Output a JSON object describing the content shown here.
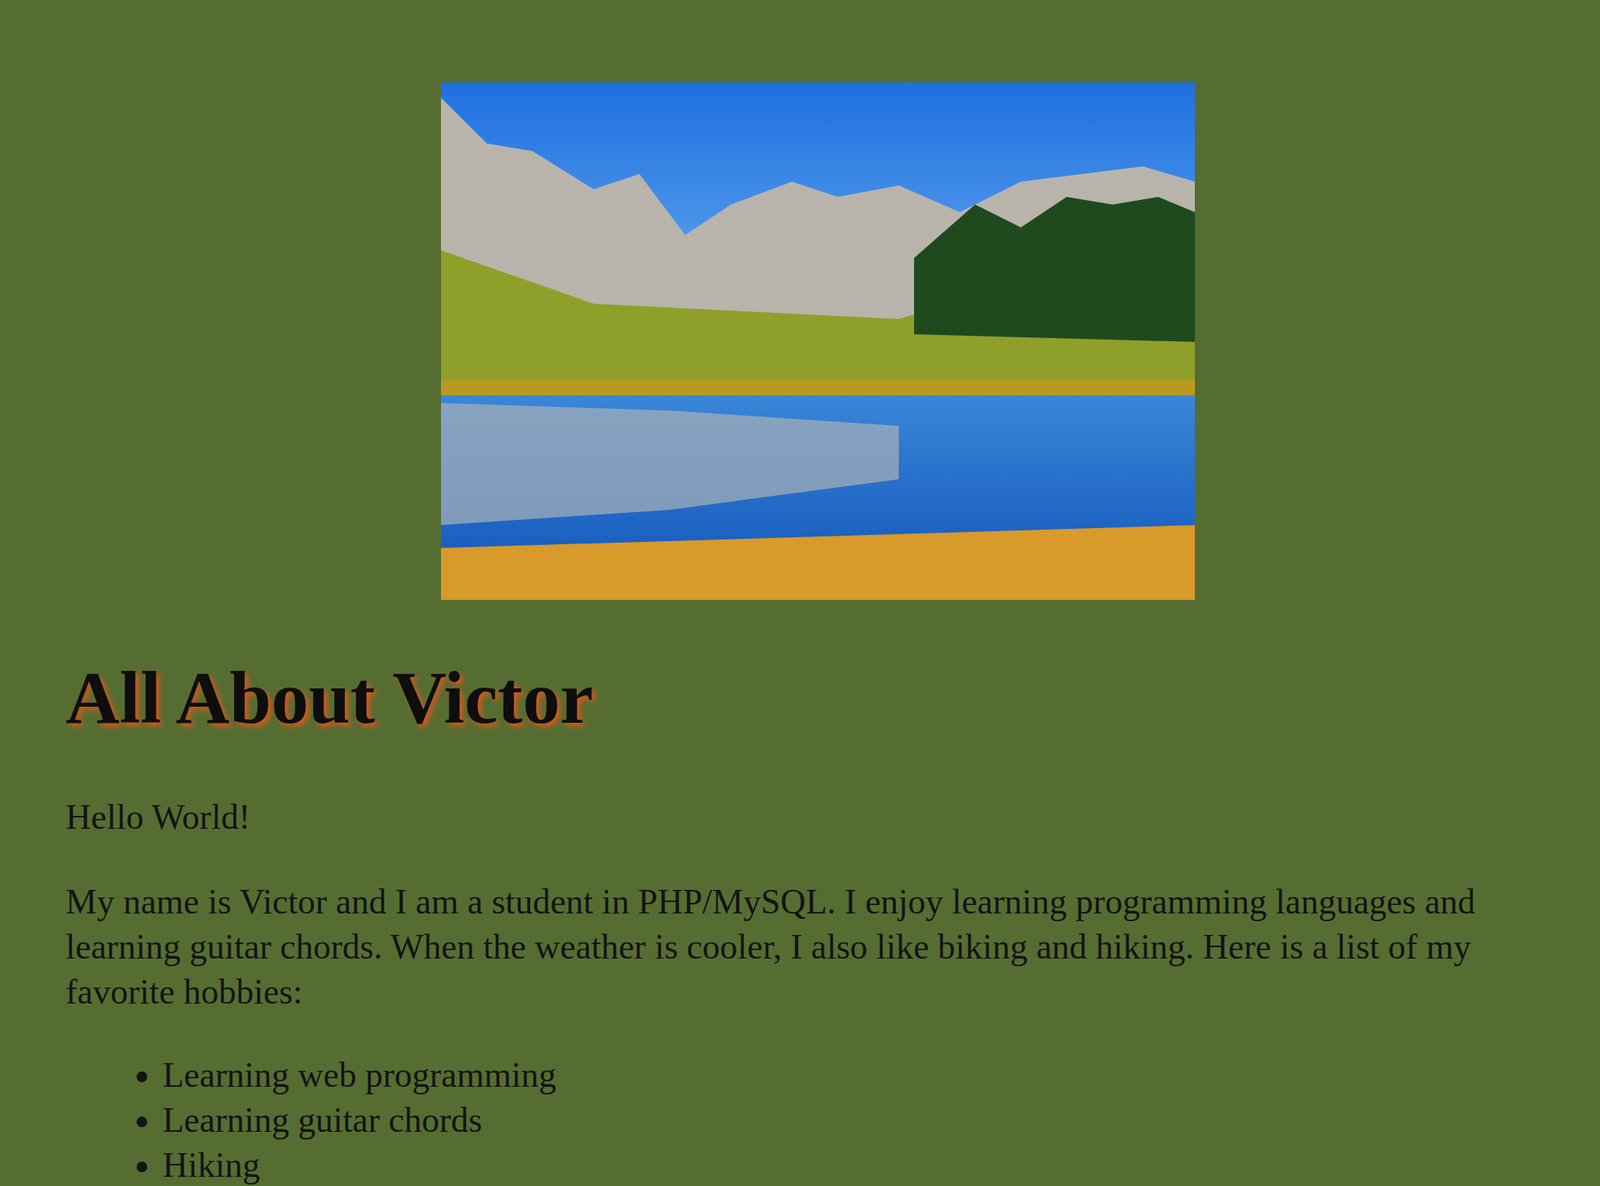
{
  "page": {
    "heading": "All About Victor",
    "paragraphs": [
      "Hello World!",
      "My name is Victor and I am a student in PHP/MySQL. I enjoy learning programming languages and learning guitar chords. When the weather is cooler, I also like biking and hiking. Here is a list of my favorite hobbies:"
    ],
    "hobbies": [
      "Learning web programming",
      "Learning guitar chords",
      "Hiking"
    ]
  }
}
